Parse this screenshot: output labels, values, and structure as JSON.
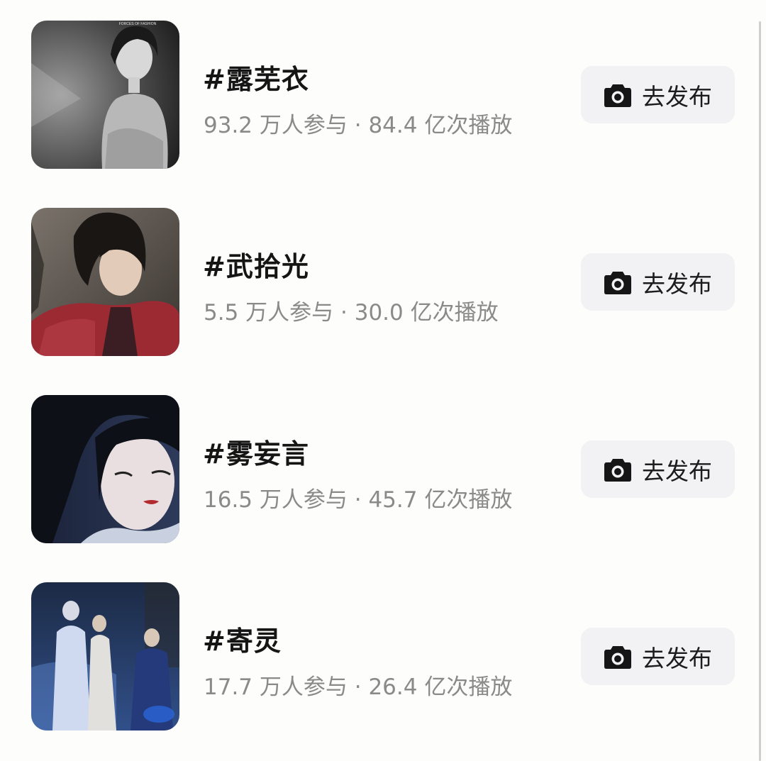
{
  "topics": [
    {
      "title": "#露芜衣",
      "stats": "93.2 万人参与 · 84.4 亿次播放",
      "thumb_watermark": "FORCES OF FASHION",
      "button_label": "去发布",
      "button_icon": "camera-icon"
    },
    {
      "title": "#武拾光",
      "stats": "5.5 万人参与 · 30.0 亿次播放",
      "button_label": "去发布",
      "button_icon": "camera-icon"
    },
    {
      "title": "#雾妄言",
      "stats": "16.5 万人参与 · 45.7 亿次播放",
      "button_label": "去发布",
      "button_icon": "camera-icon"
    },
    {
      "title": "#寄灵",
      "stats": "17.7 万人参与 · 26.4 亿次播放",
      "button_label": "去发布",
      "button_icon": "camera-icon"
    }
  ],
  "colors": {
    "background": "#fdfdfb",
    "title": "#151515",
    "stats": "#8a8a8a",
    "button_bg": "#f2f2f4",
    "button_text": "#1c1c1c"
  }
}
